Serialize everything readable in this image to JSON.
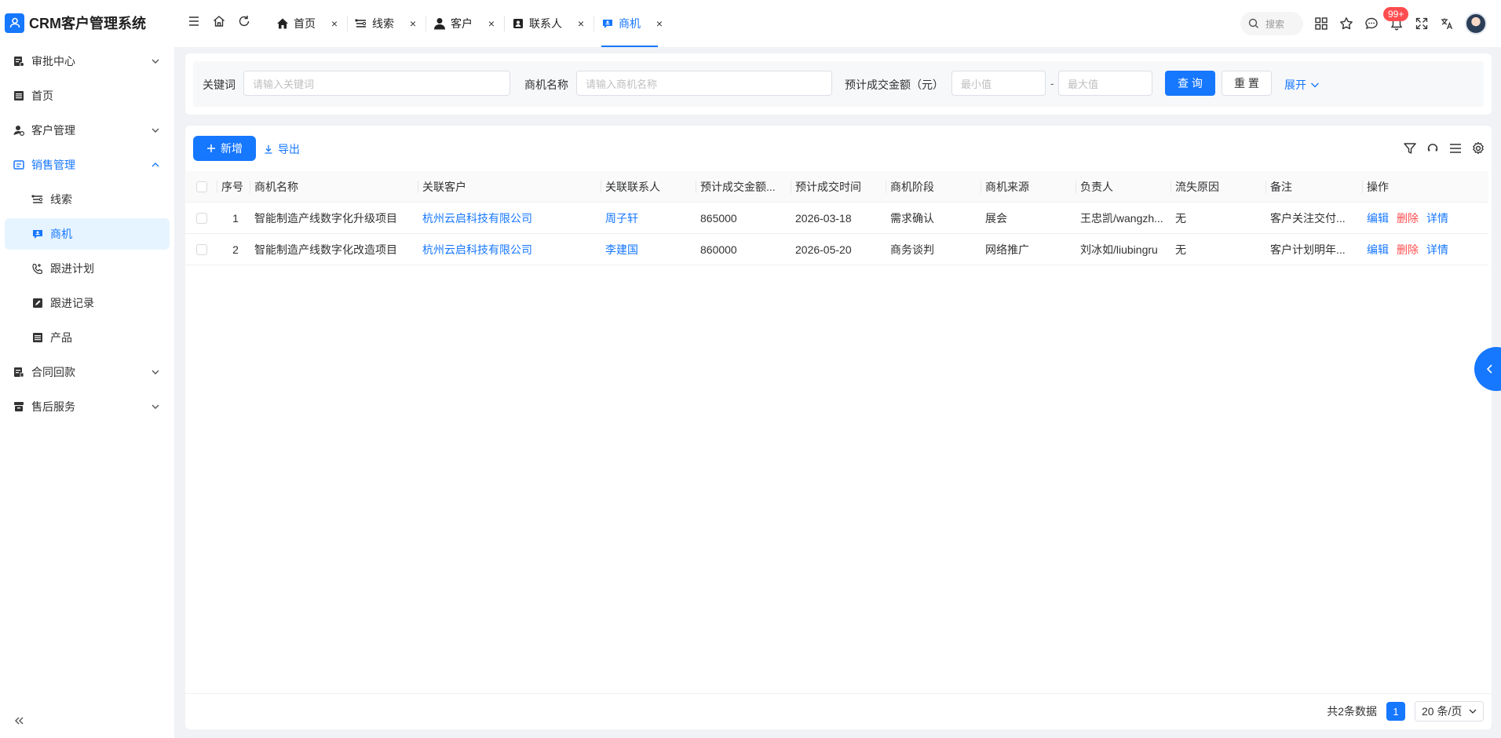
{
  "app": {
    "title": "CRM客户管理系统"
  },
  "sidebar": {
    "items": [
      {
        "label": "审批中心",
        "icon": "approval-icon",
        "expandable": true
      },
      {
        "label": "首页",
        "icon": "home-list-icon",
        "expandable": false
      },
      {
        "label": "客户管理",
        "icon": "customer-icon",
        "expandable": true
      },
      {
        "label": "销售管理",
        "icon": "sales-icon",
        "expandable": true,
        "expanded": true
      },
      {
        "label": "线索",
        "icon": "clue-icon",
        "sub": true
      },
      {
        "label": "商机",
        "icon": "opportunity-icon",
        "sub": true,
        "active": true
      },
      {
        "label": "跟进计划",
        "icon": "phone-icon",
        "sub": true
      },
      {
        "label": "跟进记录",
        "icon": "edit-icon",
        "sub": true
      },
      {
        "label": "产品",
        "icon": "product-icon",
        "sub": true
      },
      {
        "label": "合同回款",
        "icon": "contract-icon",
        "expandable": true
      },
      {
        "label": "售后服务",
        "icon": "service-icon",
        "expandable": true
      }
    ]
  },
  "tabs": [
    {
      "label": "首页",
      "icon": "home-icon"
    },
    {
      "label": "线索",
      "icon": "clue-icon"
    },
    {
      "label": "客户",
      "icon": "user-icon"
    },
    {
      "label": "联系人",
      "icon": "contact-icon"
    },
    {
      "label": "商机",
      "icon": "opportunity-icon",
      "active": true
    }
  ],
  "header": {
    "search_label": "搜索",
    "notification_count": "99+"
  },
  "filters": {
    "keyword_label": "关键词",
    "keyword_placeholder": "请输入关键词",
    "name_label": "商机名称",
    "name_placeholder": "请输入商机名称",
    "amount_label": "预计成交金额（元）",
    "min_placeholder": "最小值",
    "max_placeholder": "最大值",
    "range_sep": "-",
    "query_label": "查 询",
    "reset_label": "重 置",
    "expand_label": "展开"
  },
  "toolbar": {
    "add_label": "新增",
    "export_label": "导出"
  },
  "table": {
    "columns": [
      "序号",
      "商机名称",
      "关联客户",
      "关联联系人",
      "预计成交金额...",
      "预计成交时间",
      "商机阶段",
      "商机来源",
      "负责人",
      "流失原因",
      "备注",
      "操作"
    ],
    "rows": [
      {
        "index": "1",
        "name": "智能制造产线数字化升级项目",
        "customer": "杭州云启科技有限公司",
        "contact": "周子轩",
        "amount": "865000",
        "date": "2026-03-18",
        "stage": "需求确认",
        "source": "展会",
        "owner": "王忠凯/wangzh...",
        "loss": "无",
        "remark": "客户关注交付..."
      },
      {
        "index": "2",
        "name": "智能制造产线数字化改造项目",
        "customer": "杭州云启科技有限公司",
        "contact": "李建国",
        "amount": "860000",
        "date": "2026-05-20",
        "stage": "商务谈判",
        "source": "网络推广",
        "owner": "刘冰如/liubingru",
        "loss": "无",
        "remark": "客户计划明年..."
      }
    ],
    "actions": {
      "edit": "编辑",
      "delete": "删除",
      "detail": "详情"
    }
  },
  "pagination": {
    "total_label": "共2条数据",
    "current_page": "1",
    "page_size": "20 条/页"
  },
  "colors": {
    "primary": "#1677ff",
    "danger": "#ff4d4f"
  }
}
